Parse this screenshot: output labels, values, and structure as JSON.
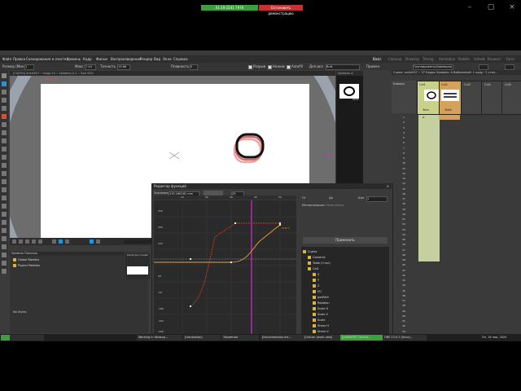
{
  "notifications": {
    "call": "01:19:2241 7976",
    "stop": "Остановить демонстрацию"
  },
  "menu": {
    "items": [
      "Файл",
      "Правка",
      "Сканирование и очистка",
      "Уровень",
      "Кадр",
      "Фильм",
      "Воспроизведение",
      "Рендер",
      "Вид",
      "Окна",
      "Справка"
    ],
    "rooms": [
      "Basic",
      "Cleanup",
      "Drawing",
      "Timing",
      "Animation",
      "Palette",
      "Xsheet",
      "Browser",
      "Farm"
    ]
  },
  "tool_options": {
    "size_label": "Размер (Мин)",
    "size_value": "1",
    "max_label": "Макс",
    "max_value": "7.44",
    "accuracy_label": "Точность",
    "accuracy_value": "19.66",
    "smooth_label": "Плавность",
    "smooth_value": "0",
    "break_label": "Разрыв",
    "pressure_label": "Нажим",
    "autocomplete_label": "Autofill",
    "cap_label": "Доп.вкл",
    "cap_value": "Butt",
    "join_label": "Примен.",
    "join_value": "Round",
    "group_value": "Группировать(Анимация)"
  },
  "viewer": {
    "header": "[СЦЕНА] ankle007 :: Кадр 20 :: Уровень A-1 :: Зум 54%",
    "camera_label": "Camera1"
  },
  "level_strip": {
    "header": "Уровень A",
    "frame_label": "0001"
  },
  "function_editor": {
    "title": "Редактор функций",
    "value_label": "Значение:",
    "value": "135.186161 mm",
    "frame_value": "29",
    "from_label": "От",
    "to_label": "До",
    "step_label": "Шаг",
    "step_value": "1",
    "interp_label": "Интерполяция:",
    "interp_value": "Нелинейная",
    "apply_button": "Применить",
    "y_ticks": [
      "250",
      "200",
      "150",
      "50",
      "-50",
      "-100",
      "-150",
      "-200"
    ],
    "x_ticks": [
      "10",
      "20",
      "30",
      "40",
      "50",
      "60"
    ],
    "curve_label": "Col1.Y",
    "tree": [
      "Сцена",
      "Camera1",
      "Table (Стол)",
      "Col1",
      "X",
      "Y",
      "Z",
      "SO",
      "posPath",
      "Rotation",
      "Scale H",
      "Scale V",
      "Scale",
      "Shear H",
      "Shear V"
    ]
  },
  "xsheet": {
    "header": "Сцена: ankle007  :: 37 Кадры  Уровень: A  Выбранный: 1 кадр : 1 стол...",
    "camera_col": "Камера",
    "columns": [
      "Col1",
      "Col2",
      "Col3",
      "Col4",
      "Col5"
    ],
    "col1_name": "Tacе",
    "col2_name": "Table",
    "frames": [
      "1",
      "2",
      "3",
      "4",
      "5",
      "6",
      "7",
      "8",
      "9",
      "10",
      "11",
      "12",
      "13",
      "14",
      "15",
      "16",
      "17",
      "18",
      "19",
      "20",
      "21",
      "22",
      "23",
      "24",
      "25",
      "26",
      "27",
      "28",
      "29",
      "30",
      "31",
      "32",
      "33",
      "34",
      "35",
      "36",
      "37",
      "38",
      "39",
      "40",
      "41",
      "42",
      "43",
      "44",
      "45",
      "46",
      "47",
      "48",
      "49",
      "50",
      "51",
      "52"
    ],
    "cell_marker": "A"
  },
  "palette": {
    "header": "Уровень Палитра",
    "tree": [
      "Global Palettes",
      "Project Palettes"
    ],
    "style_header": "Палитра стилей",
    "no_styles": "No Styles"
  },
  "taskbar": {
    "tasks": [
      "",
      "Working in ilshwvp...",
      "[translation]",
      "Терминал",
      "[lecturtantaion.mk...",
      "[Unicon (work-new]",
      "[profile007 (scena...",
      "OBS 23.0.3 (linux)..."
    ],
    "clock": "Пн, 16 ноя, 2020"
  },
  "colors": {
    "accent": "#2f8fd6",
    "curve_red": "#cc3a2c",
    "curve_orange": "#e8a03a",
    "cursor_magenta": "#d62bd6",
    "xsheet_cell": "#c6cfa0"
  }
}
